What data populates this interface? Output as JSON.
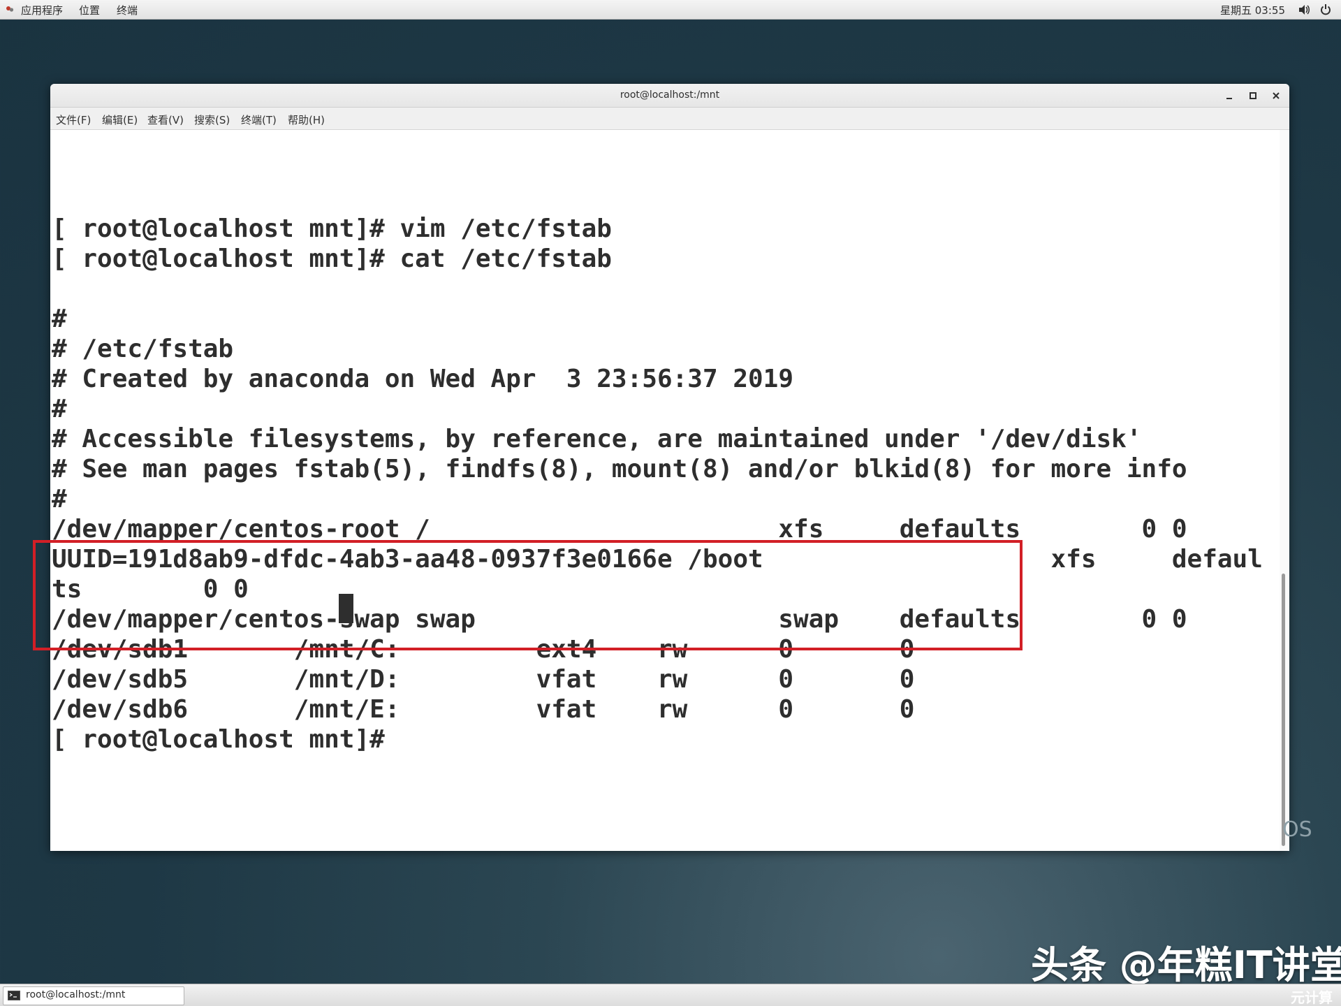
{
  "top_panel": {
    "apps_label": "应用程序",
    "places_label": "位置",
    "terminal_label": "终端",
    "clock": "星期五 03:55"
  },
  "window": {
    "title": "root@localhost:/mnt",
    "menu": [
      "文件(F)",
      "编辑(E)",
      "查看(V)",
      "搜索(S)",
      "终端(T)",
      "帮助(H)"
    ]
  },
  "terminal": {
    "lines": [
      "[ root@localhost mnt]# vim /etc/fstab",
      "[ root@localhost mnt]# cat /etc/fstab",
      "",
      "#",
      "# /etc/fstab",
      "# Created by anaconda on Wed Apr  3 23:56:37 2019",
      "#",
      "# Accessible filesystems, by reference, are maintained under '/dev/disk'",
      "# See man pages fstab(5), findfs(8), mount(8) and/or blkid(8) for more info",
      "#",
      "/dev/mapper/centos-root /                       xfs     defaults        0 0",
      "UUID=191d8ab9-dfdc-4ab3-aa48-0937f3e0166e /boot                   xfs     defaul",
      "ts        0 0",
      "/dev/mapper/centos-swap swap                    swap    defaults        0 0",
      "/dev/sdb1       /mnt/C:         ext4    rw      0       0",
      "/dev/sdb5       /mnt/D:         vfat    rw      0       0",
      "/dev/sdb6       /mnt/E:         vfat    rw      0       0",
      "[ root@localhost mnt]# "
    ]
  },
  "wallpaper_text": "OS",
  "watermark": "头条 @年糕IT讲堂",
  "taskbar": {
    "task_label": "root@localhost:/mnt",
    "corner_label": "元计算"
  },
  "colors": {
    "highlight_border": "#d21f26",
    "terminal_text": "#2e2e2e",
    "terminal_bg": "#ffffff"
  }
}
